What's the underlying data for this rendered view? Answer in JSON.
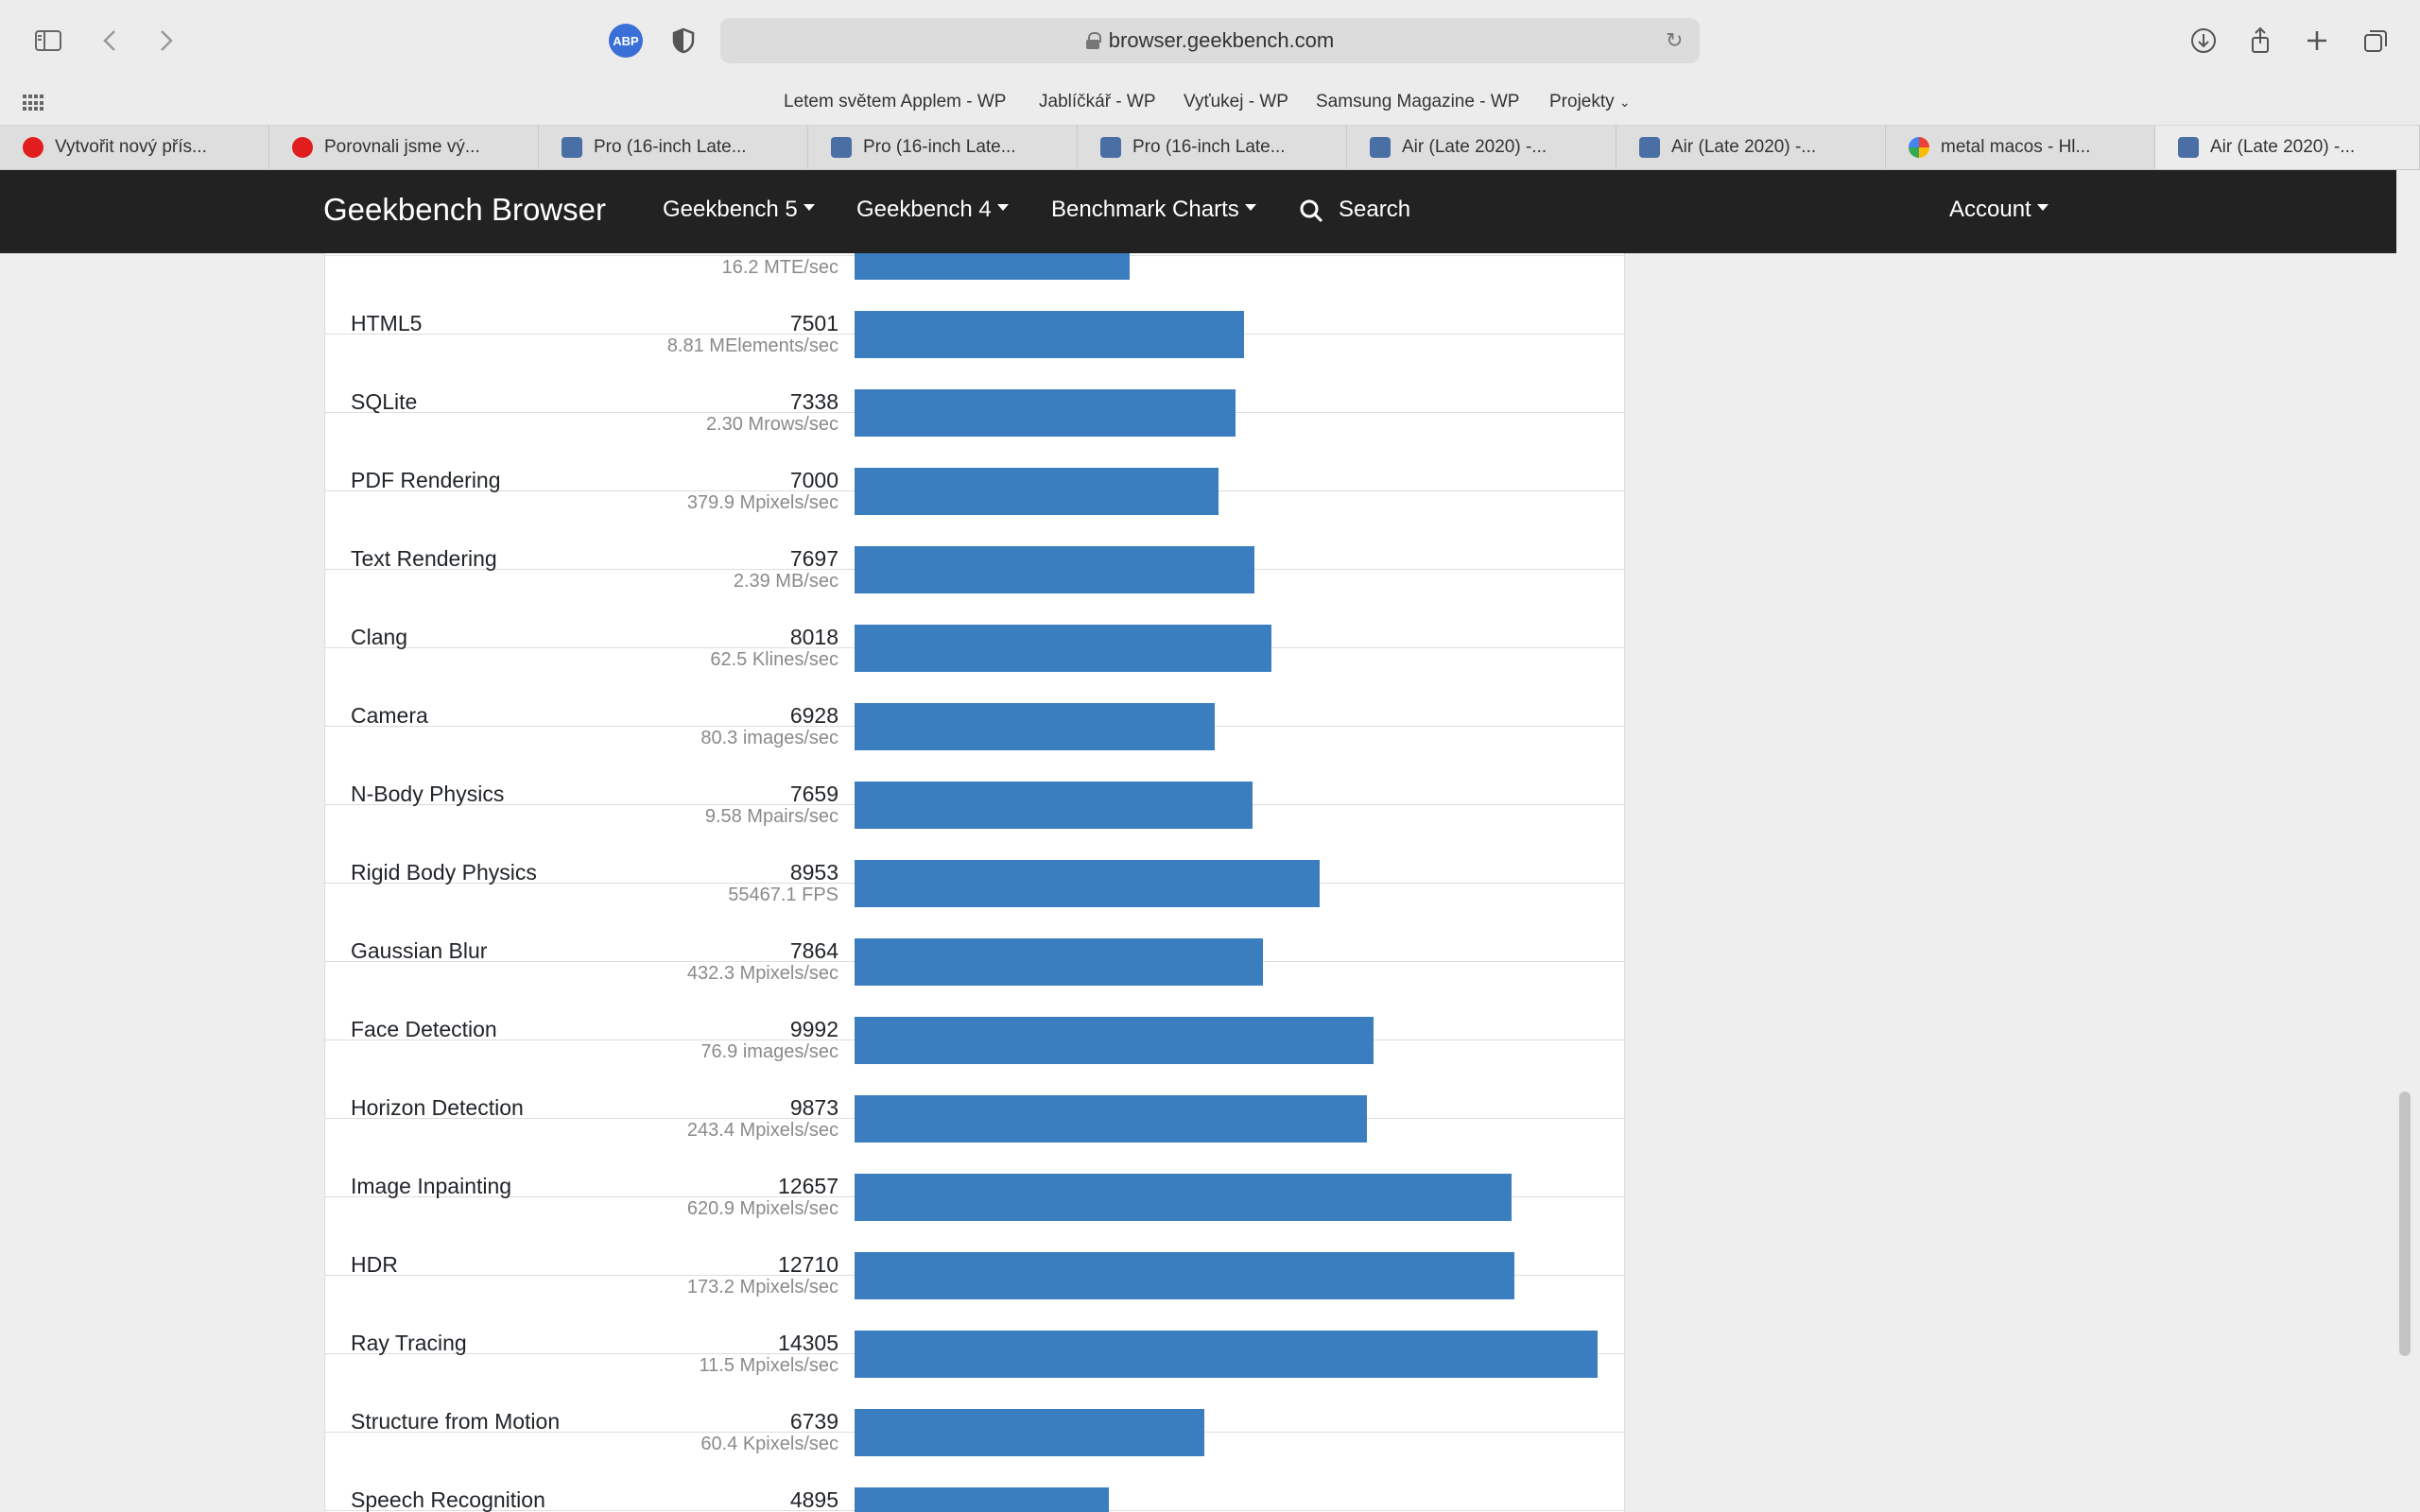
{
  "browser": {
    "url": "browser.geekbench.com",
    "adblock_badge": "ABP",
    "favorites": [
      "Letem světem Applem - WP",
      "Jablíčkář - WP",
      "Vyťukej - WP",
      "Samsung Magazine - WP",
      "Projekty"
    ],
    "tabs": [
      {
        "title": "Vytvořit nový přís...",
        "icon": "vodafone-icon"
      },
      {
        "title": "Porovnali jsme vý...",
        "icon": "vodafone-icon"
      },
      {
        "title": "Pro (16-inch Late...",
        "icon": "geekbench-icon"
      },
      {
        "title": "Pro (16-inch Late...",
        "icon": "geekbench-icon"
      },
      {
        "title": "Pro (16-inch Late...",
        "icon": "geekbench-icon"
      },
      {
        "title": "Air (Late 2020) -...",
        "icon": "geekbench-icon"
      },
      {
        "title": "Air (Late 2020) -...",
        "icon": "geekbench-icon"
      },
      {
        "title": "metal macos - Hl...",
        "icon": "google-icon"
      },
      {
        "title": "Air (Late 2020) -...",
        "icon": "geekbench-icon",
        "active": true
      }
    ]
  },
  "site": {
    "brand": "Geekbench Browser",
    "nav": [
      "Geekbench 5",
      "Geekbench 4",
      "Benchmark Charts"
    ],
    "search": "Search",
    "account": "Account"
  },
  "colors": {
    "bar": "#3a7ebf",
    "nav_bg": "#222222"
  },
  "benchmarks": [
    {
      "name": "",
      "score": "",
      "rate": "16.2 MTE/sec",
      "value": 5300
    },
    {
      "name": "HTML5",
      "score": "7501",
      "rate": "8.81 MElements/sec",
      "value": 7501
    },
    {
      "name": "SQLite",
      "score": "7338",
      "rate": "2.30 Mrows/sec",
      "value": 7338
    },
    {
      "name": "PDF Rendering",
      "score": "7000",
      "rate": "379.9 Mpixels/sec",
      "value": 7000
    },
    {
      "name": "Text Rendering",
      "score": "7697",
      "rate": "2.39 MB/sec",
      "value": 7697
    },
    {
      "name": "Clang",
      "score": "8018",
      "rate": "62.5 Klines/sec",
      "value": 8018
    },
    {
      "name": "Camera",
      "score": "6928",
      "rate": "80.3 images/sec",
      "value": 6928
    },
    {
      "name": "N-Body Physics",
      "score": "7659",
      "rate": "9.58 Mpairs/sec",
      "value": 7659
    },
    {
      "name": "Rigid Body Physics",
      "score": "8953",
      "rate": "55467.1 FPS",
      "value": 8953
    },
    {
      "name": "Gaussian Blur",
      "score": "7864",
      "rate": "432.3 Mpixels/sec",
      "value": 7864
    },
    {
      "name": "Face Detection",
      "score": "9992",
      "rate": "76.9 images/sec",
      "value": 9992
    },
    {
      "name": "Horizon Detection",
      "score": "9873",
      "rate": "243.4 Mpixels/sec",
      "value": 9873
    },
    {
      "name": "Image Inpainting",
      "score": "12657",
      "rate": "620.9 Mpixels/sec",
      "value": 12657
    },
    {
      "name": "HDR",
      "score": "12710",
      "rate": "173.2 Mpixels/sec",
      "value": 12710
    },
    {
      "name": "Ray Tracing",
      "score": "14305",
      "rate": "11.5 Mpixels/sec",
      "value": 14305
    },
    {
      "name": "Structure from Motion",
      "score": "6739",
      "rate": "60.4 Kpixels/sec",
      "value": 6739
    },
    {
      "name": "Speech Recognition",
      "score": "4895",
      "rate": "",
      "value": 4895
    }
  ],
  "bar_scale_max": 14305
}
